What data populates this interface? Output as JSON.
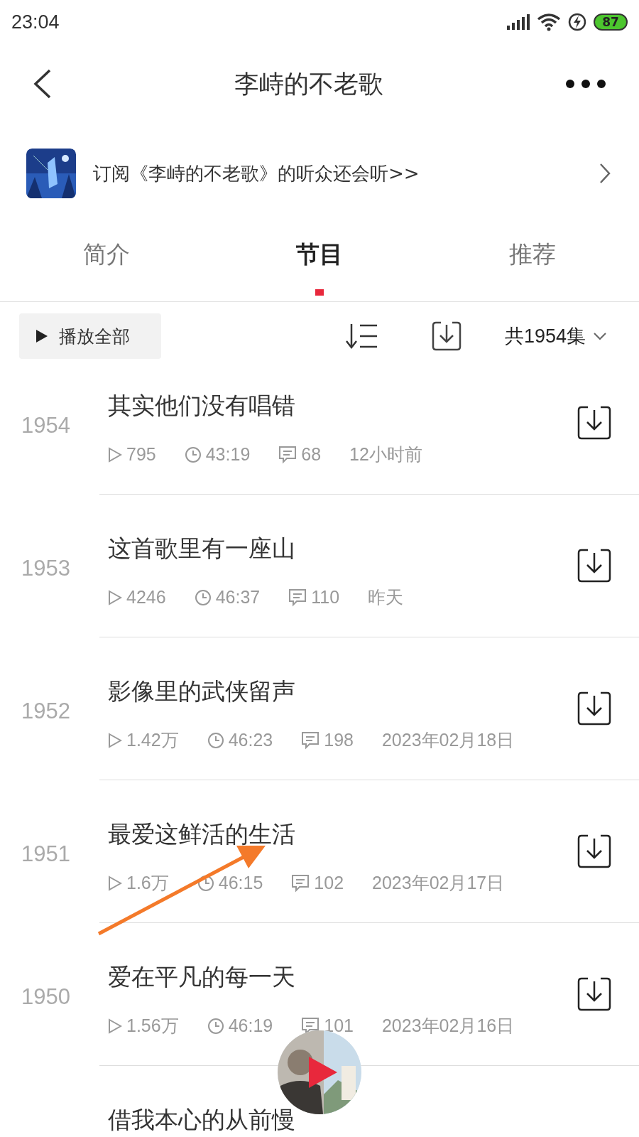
{
  "status_bar": {
    "time": "23:04",
    "battery": "87"
  },
  "header": {
    "title": "李峙的不老歌"
  },
  "banner": {
    "text": "订阅《李峙的不老歌》的听众还会听>>"
  },
  "tabs": [
    {
      "label": "简介",
      "selected": false
    },
    {
      "label": "节目",
      "selected": true
    },
    {
      "label": "推荐",
      "selected": false
    }
  ],
  "toolbar": {
    "play_all": "播放全部",
    "count": "共1954集"
  },
  "episodes": [
    {
      "number": "1954",
      "title": "其实他们没有唱错",
      "plays": "795",
      "duration": "43:19",
      "comments": "68",
      "date": "12小时前"
    },
    {
      "number": "1953",
      "title": "这首歌里有一座山",
      "plays": "4246",
      "duration": "46:37",
      "comments": "110",
      "date": "昨天"
    },
    {
      "number": "1952",
      "title": "影像里的武侠留声",
      "plays": "1.42万",
      "duration": "46:23",
      "comments": "198",
      "date": "2023年02月18日"
    },
    {
      "number": "1951",
      "title": "最爱这鲜活的生活",
      "plays": "1.6万",
      "duration": "46:15",
      "comments": "102",
      "date": "2023年02月17日"
    },
    {
      "number": "1950",
      "title": "爱在平凡的每一天",
      "plays": "1.56万",
      "duration": "46:19",
      "comments": "101",
      "date": "2023年02月16日"
    },
    {
      "title": "借我本心的从前慢"
    }
  ]
}
